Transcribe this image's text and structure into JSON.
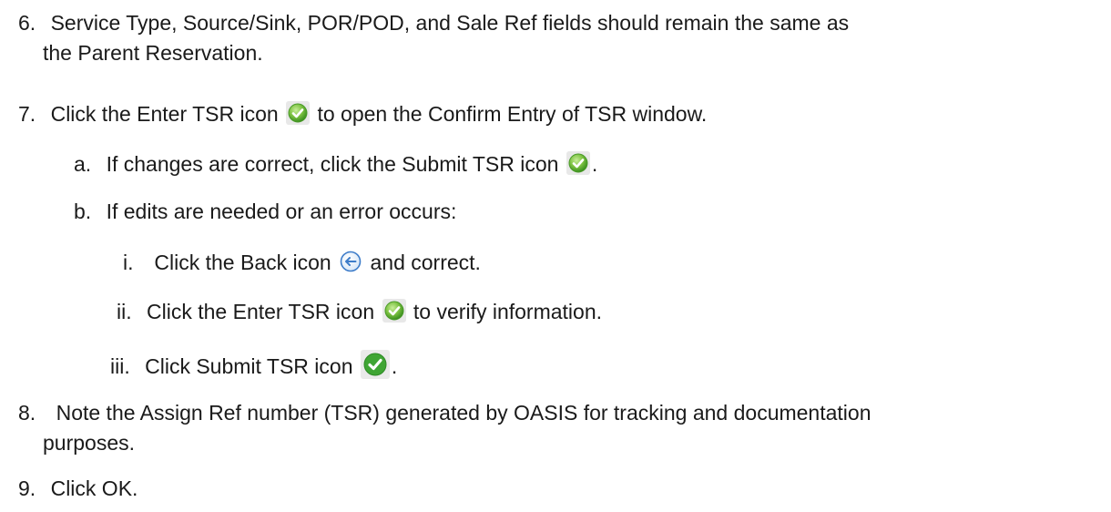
{
  "steps": {
    "s6": {
      "num": "6.",
      "line1": "Service Type, Source/Sink, POR/POD, and Sale Ref fields should remain the same as",
      "line2": "the Parent Reservation."
    },
    "s7": {
      "num": "7.",
      "before": "Click the Enter TSR icon",
      "after": "to open the Confirm Entry of TSR window.",
      "icon": "enter-tsr-check-icon",
      "substeps": {
        "a": {
          "num": "a.",
          "before": "If changes are correct, click the Submit TSR icon",
          "after": ".",
          "icon": "submit-tsr-check-icon"
        },
        "b": {
          "num": "b.",
          "text": "If edits are needed or an error occurs:",
          "items": {
            "i": {
              "num": "i.",
              "before": "Click the Back icon",
              "after": "and correct.",
              "icon": "back-arrow-icon"
            },
            "ii": {
              "num": "ii.",
              "before": "Click the Enter TSR icon",
              "after": "to verify information.",
              "icon": "enter-tsr-check-icon"
            },
            "iii": {
              "num": "iii.",
              "before": "Click Submit TSR icon",
              "after": ".",
              "icon": "submit-tsr-check-icon"
            }
          }
        }
      }
    },
    "s8": {
      "num": "8.",
      "line1": "Note the Assign Ref number (TSR) generated by OASIS for tracking and documentation",
      "line2": "purposes."
    },
    "s9": {
      "num": "9.",
      "text": "Click OK."
    }
  },
  "colors": {
    "check_green_light": "#7dc242",
    "check_green_dark": "#3a8f1e",
    "back_blue": "#3d7cc9"
  }
}
